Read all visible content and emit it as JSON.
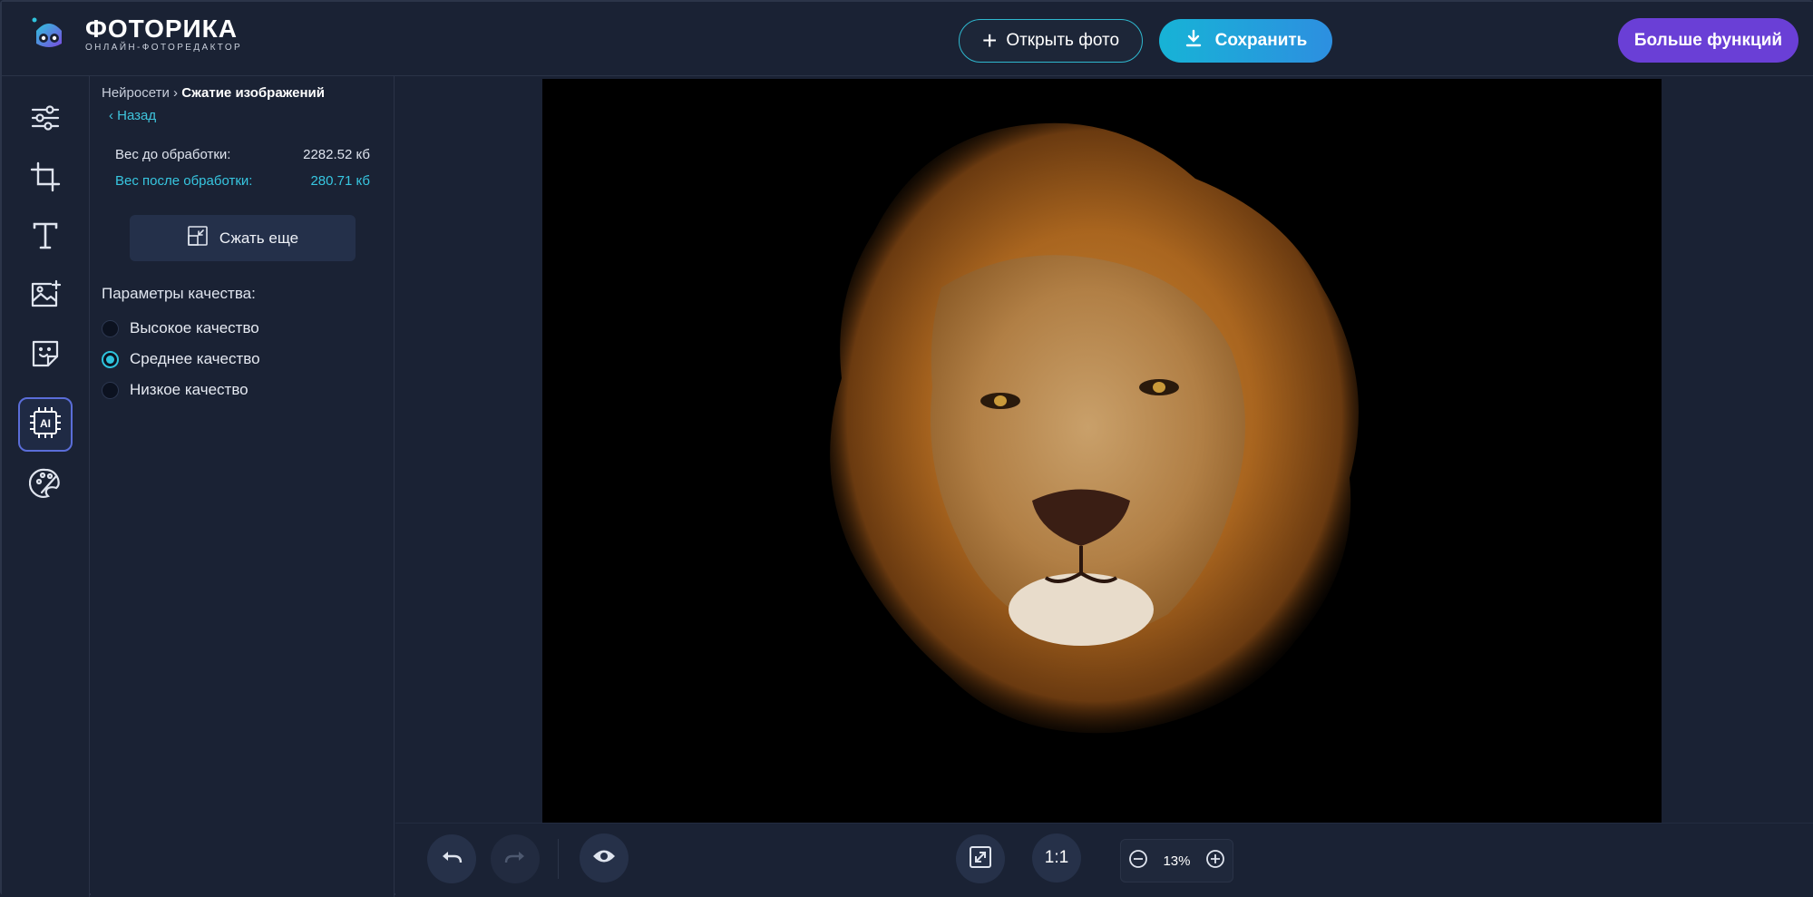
{
  "app": {
    "logo_title": "ФОТОРИКА",
    "logo_subtitle": "ОНЛАЙН-ФОТОРЕДАКТОР",
    "accent": "#2fc3dc",
    "brand_purple": "#6a3fd6"
  },
  "header": {
    "open_label": "Открыть фото",
    "save_label": "Сохранить",
    "more_label": "Больше функций"
  },
  "tools": [
    {
      "name": "adjust-icon"
    },
    {
      "name": "crop-icon"
    },
    {
      "name": "text-icon"
    },
    {
      "name": "add-image-icon"
    },
    {
      "name": "sticker-icon"
    },
    {
      "name": "ai-icon",
      "active": true,
      "label": "AI"
    },
    {
      "name": "palette-icon"
    }
  ],
  "panel": {
    "breadcrumb_parent": "Нейросети",
    "breadcrumb_sep": "›",
    "breadcrumb_current": "Сжатие изображений",
    "back_label": "‹ Назад",
    "weight_before_label": "Вес до обработки:",
    "weight_before_value": "2282.52 кб",
    "weight_after_label": "Вес после обработки:",
    "weight_after_value": "280.71 кб",
    "compress_button": "Сжать еще",
    "quality_title": "Параметры качества:",
    "quality_options": [
      {
        "label": "Высокое качество",
        "selected": false
      },
      {
        "label": "Среднее качество",
        "selected": true
      },
      {
        "label": "Низкое качество",
        "selected": false
      }
    ]
  },
  "bottombar": {
    "ratio_label": "1:1",
    "zoom_value": "13%"
  }
}
